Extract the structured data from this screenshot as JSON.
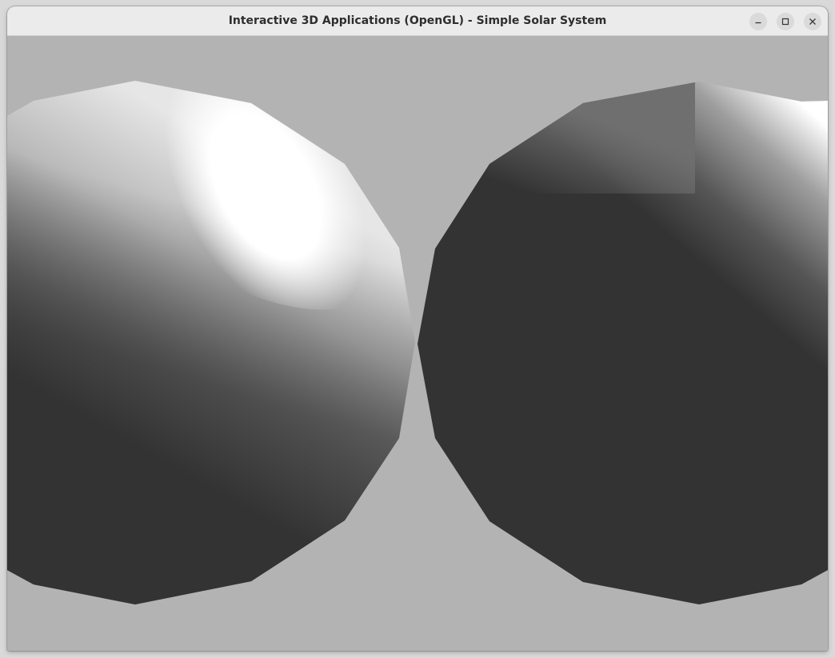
{
  "window": {
    "title": "Interactive 3D Applications (OpenGL) - Simple Solar System"
  },
  "titlebar_buttons": [
    {
      "name": "minimize-button",
      "icon": "minimize-icon"
    },
    {
      "name": "maximize-button",
      "icon": "maximize-icon"
    },
    {
      "name": "close-button",
      "icon": "close-icon"
    }
  ],
  "scene": {
    "background_color": "#b3b3b3",
    "shadow_color": "#333333",
    "highlight_color": "#ffffff",
    "objects": [
      {
        "name": "left-sphere",
        "lighting": "lit from upper-right"
      },
      {
        "name": "right-sphere",
        "lighting": "lit from upper-right edge"
      }
    ]
  }
}
